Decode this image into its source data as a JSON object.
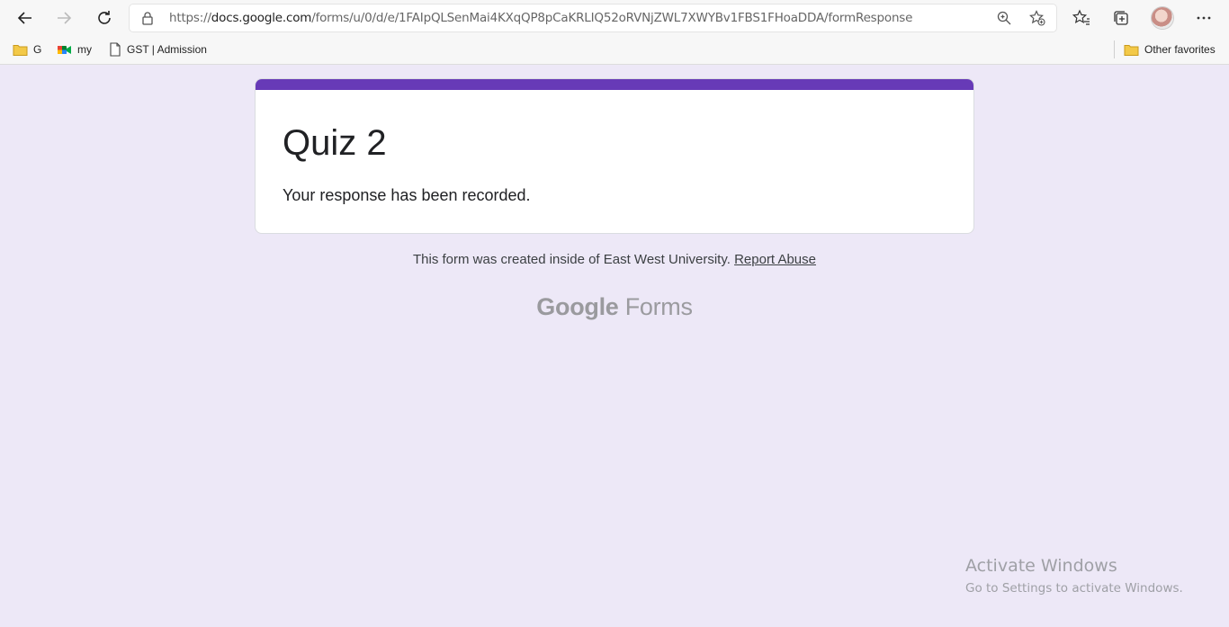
{
  "browser": {
    "url_prefix": "https://",
    "url_host": "docs.google.com",
    "url_path": "/forms/u/0/d/e/1FAIpQLSenMai4KXqQP8pCaKRLIQ52oRVNjZWL7XWYBv1FBS1FHoaDDA/formResponse",
    "bookmarks": [
      {
        "label": "G",
        "icon": "folder-icon"
      },
      {
        "label": "my",
        "icon": "google-meet-icon"
      },
      {
        "label": "GST | Admission",
        "icon": "page-icon"
      }
    ],
    "other_favorites": "Other favorites",
    "accent_folder_color": "#f3c948"
  },
  "form": {
    "title": "Quiz 2",
    "message": "Your response has been recorded.",
    "accent_color": "#673ab7",
    "background_color": "#ede8f7"
  },
  "footer": {
    "note": "This form was created inside of East West University.",
    "report_link": "Report Abuse",
    "logo_google": "Google",
    "logo_forms": "Forms"
  },
  "watermark": {
    "title": "Activate Windows",
    "subtitle": "Go to Settings to activate Windows."
  }
}
